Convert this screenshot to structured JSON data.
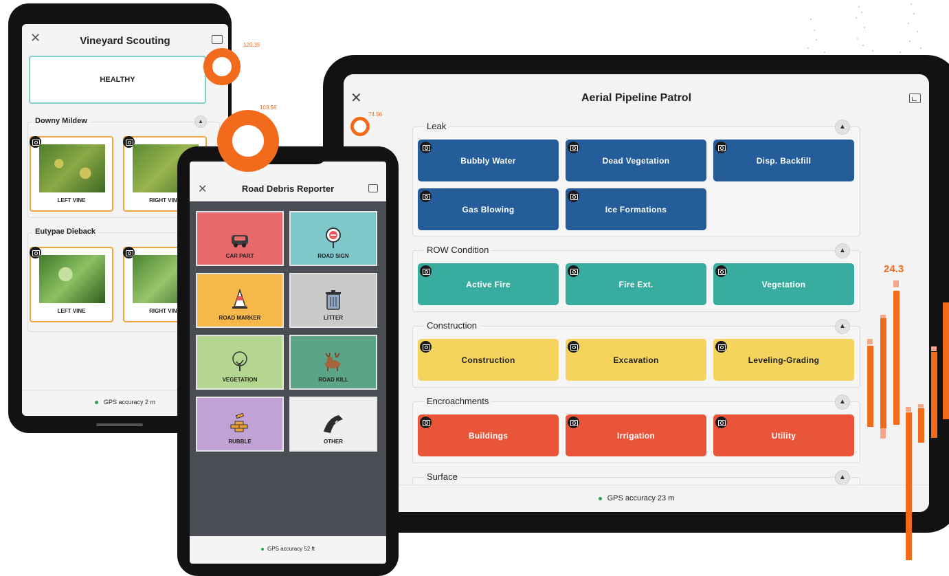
{
  "vineyard": {
    "title": "Vineyard Scouting",
    "status_button": "HEALTHY",
    "sections": [
      {
        "label": "Downy Mildew",
        "items": [
          "LEFT VINE",
          "RIGHT VINE"
        ]
      },
      {
        "label": "Eutypae Dieback",
        "items": [
          "LEFT VINE",
          "RIGHT VINE"
        ]
      }
    ],
    "gps": "GPS accuracy 2 m"
  },
  "phone": {
    "title": "Road Debris Reporter",
    "tiles": [
      {
        "label": "CAR PART",
        "color": "#e8696b",
        "icon": "car-icon"
      },
      {
        "label": "ROAD SIGN",
        "color": "#7ec8cb",
        "icon": "road-sign-icon"
      },
      {
        "label": "ROAD MARKER",
        "color": "#f7b84b",
        "icon": "traffic-cone-icon"
      },
      {
        "label": "LITTER",
        "color": "#c9c9c9",
        "icon": "trash-can-icon"
      },
      {
        "label": "VEGETATION",
        "color": "#b5d690",
        "icon": "tree-icon"
      },
      {
        "label": "ROAD KILL",
        "color": "#5ba488",
        "icon": "moose-icon"
      },
      {
        "label": "RUBBLE",
        "color": "#c0a3d4",
        "icon": "bricks-icon"
      },
      {
        "label": "OTHER",
        "color": "#efefef",
        "icon": "road-icon"
      }
    ],
    "gps": "GPS accuracy 52 ft"
  },
  "tablet": {
    "title": "Aerial Pipeline Patrol",
    "sections": [
      {
        "label": "Leak",
        "color": "#245d9a",
        "buttons": [
          "Bubbly Water",
          "Dead Vegetation",
          "Disp. Backfill",
          "Gas Blowing",
          "Ice  Formations"
        ]
      },
      {
        "label": "ROW Condition",
        "color": "#38ad9f",
        "buttons": [
          "Active Fire",
          "Fire Ext.",
          "Vegetation"
        ]
      },
      {
        "label": "Construction",
        "color": "#f4d45d",
        "buttons": [
          "Construction",
          "Excavation",
          "Leveling-Grading"
        ]
      },
      {
        "label": "Encroachments",
        "color": "#ea553a",
        "buttons": [
          "Buildings",
          "Irrigation",
          "Utility"
        ]
      },
      {
        "label": "Surface",
        "color": "#888888",
        "buttons": []
      }
    ],
    "gps": "GPS accuracy 23 m"
  },
  "decor": {
    "accent": "#f26b1d",
    "readout_1": "120.35",
    "readout_2": "103.56",
    "readout_3": "74.56",
    "bar_value": "24.3"
  }
}
